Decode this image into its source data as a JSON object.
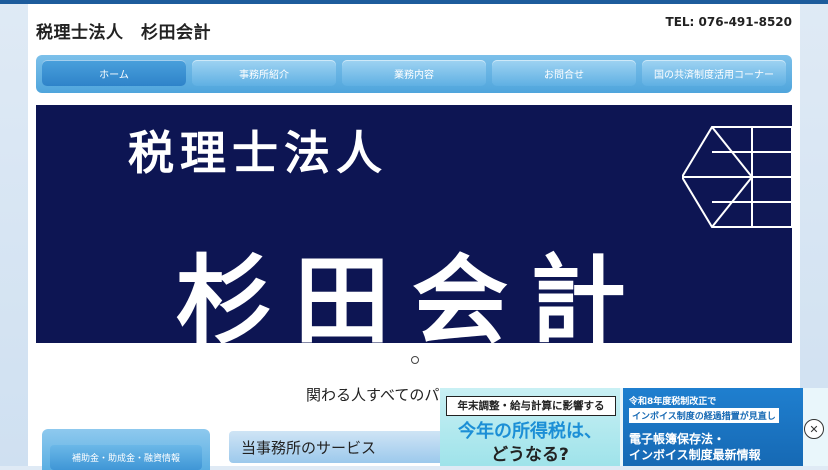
{
  "header": {
    "title": "税理士法人　杉田会計",
    "tel": "TEL: 076-491-8520"
  },
  "nav": {
    "items": [
      {
        "label": "ホーム"
      },
      {
        "label": "事務所紹介"
      },
      {
        "label": "業務内容"
      },
      {
        "label": "お問合せ"
      },
      {
        "label": "国の共済制度活用コーナー"
      }
    ]
  },
  "hero": {
    "line1": "税理士法人",
    "line2": "杉田会計"
  },
  "main": {
    "tagline": "関わる人すべてのパートナーへ",
    "service_heading": "当事務所のサービス"
  },
  "sidebar": {
    "button_label": "補助金・助成金・融資情報"
  },
  "ad": {
    "left_line1": "年末調整・給与計算に影響する",
    "left_line2": "今年の所得税は、",
    "left_line3": "どうなる?",
    "right_line1": "令和8年度税制改正で",
    "right_line2": "インボイス制度の経過措置が見直し",
    "right_line3": "電子帳簿保存法・",
    "right_line4": "インボイス制度最新情報",
    "close_icon": "close-icon"
  }
}
